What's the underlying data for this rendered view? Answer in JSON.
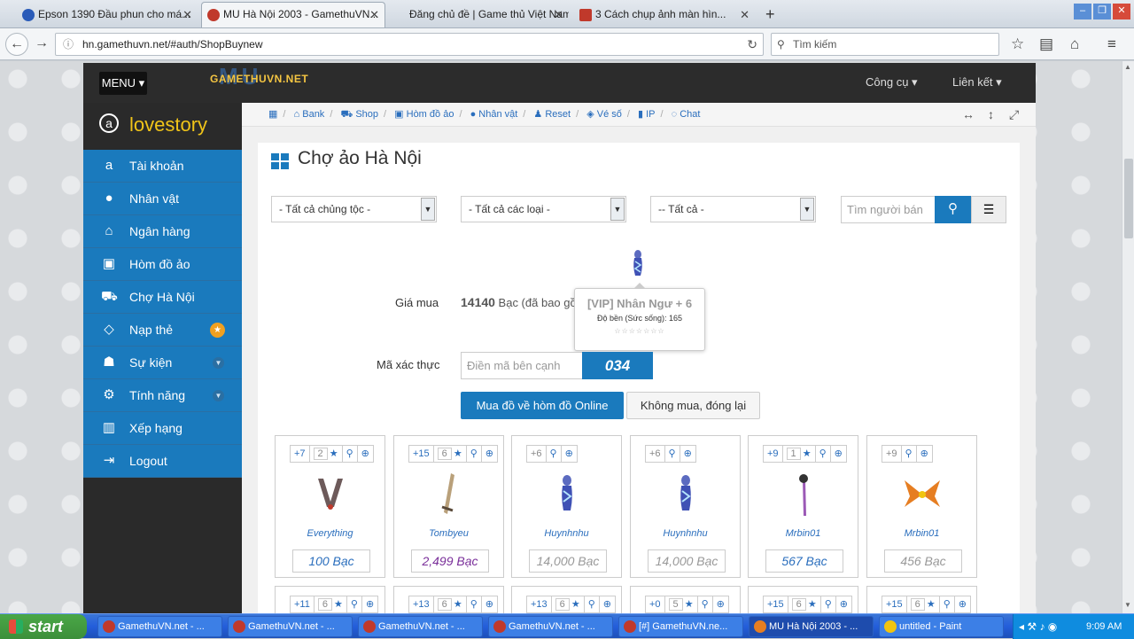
{
  "browser": {
    "tabs": [
      {
        "label": "Epson 1390 Đầu phun cho má...",
        "color": "#2a5bb8"
      },
      {
        "label": "MU Hà Nội 2003 - GamethuVN...",
        "color": "#c0392b"
      },
      {
        "label": "Đăng chủ đề | Game thủ Việt Nam...",
        "color": "#c0392b"
      },
      {
        "label": "3 Cách chụp ảnh màn hìn...",
        "color": "#c0392b"
      }
    ],
    "url": "hn.gamethuvn.net/#auth/ShopBuynew",
    "search_placeholder": "Tìm kiếm"
  },
  "site": {
    "menu_label": "MENU ▾",
    "logo_text": "GAMETHUVN.NET",
    "logo_mu": "MU",
    "nav_tools": "Công cụ ▾",
    "nav_links": "Liên kết ▾"
  },
  "sidebar": {
    "user": "lovestory",
    "items": [
      {
        "label": "Tài khoản"
      },
      {
        "label": "Nhân vật"
      },
      {
        "label": "Ngân hàng"
      },
      {
        "label": "Hòm đồ ảo"
      },
      {
        "label": "Chợ Hà Nội"
      },
      {
        "label": "Nạp thẻ"
      },
      {
        "label": "Sự kiện"
      },
      {
        "label": "Tính năng"
      },
      {
        "label": "Xếp hạng"
      },
      {
        "label": "Logout"
      }
    ]
  },
  "breadcrumbs": [
    "Bank",
    "Shop",
    "Hòm đồ ảo",
    "Nhân vật",
    "Reset",
    "Vé số",
    "IP",
    "Chat"
  ],
  "main": {
    "title": "Chợ ảo Hà Nội",
    "filter_race": "- Tất cả chủng tộc -",
    "filter_type": "- Tất cả các loại -",
    "filter_all": "-- Tất cả -",
    "seller_placeholder": "Tìm người bán",
    "price_label": "Giá mua",
    "price_value": "14140",
    "price_suffix": " Bạc (đã bao gồm",
    "captcha_label": "Mã xác thực",
    "captcha_placeholder": "Điền mã bên cạnh",
    "captcha_text": "034",
    "buy_button": "Mua đồ về hòm đồ Online",
    "cancel_button": "Không mua, đóng lại"
  },
  "tooltip": {
    "title": "[VIP] Nhân Ngư + 6",
    "line": "Độ bền (Sức sống): 165",
    "stars": "☆☆☆☆☆☆☆"
  },
  "items": [
    {
      "level": "+7",
      "stars": "2",
      "seller": "Everything",
      "price": "100 Bạc",
      "active": true,
      "color": "#2a6ebd"
    },
    {
      "level": "+15",
      "stars": "6",
      "seller": "Tombyeu",
      "price": "2,499 Bạc",
      "active": true,
      "color": "#7a2f9a"
    },
    {
      "level": "+6",
      "stars": "",
      "seller": "Huynhnhu",
      "price": "14,000 Bạc",
      "active": false,
      "color": "#999999"
    },
    {
      "level": "+6",
      "stars": "",
      "seller": "Huynhnhu",
      "price": "14,000 Bạc",
      "active": false,
      "color": "#999999"
    },
    {
      "level": "+9",
      "stars": "1",
      "seller": "Mrbin01",
      "price": "567 Bạc",
      "active": true,
      "color": "#2a6ebd"
    },
    {
      "level": "+9",
      "stars": "",
      "seller": "Mrbin01",
      "price": "456 Bạc",
      "active": false,
      "color": "#999999"
    }
  ],
  "items_row2": [
    {
      "level": "+11",
      "stars": "6"
    },
    {
      "level": "+13",
      "stars": "6"
    },
    {
      "level": "+13",
      "stars": "6"
    },
    {
      "level": "+0",
      "stars": "5"
    },
    {
      "level": "+15",
      "stars": "6"
    },
    {
      "level": "+15",
      "stars": "6"
    }
  ],
  "taskbar": {
    "start": "start",
    "items": [
      "GamethuVN.net - ...",
      "GamethuVN.net - ...",
      "GamethuVN.net - ...",
      "GamethuVN.net - ...",
      "[#] GamethuVN.ne...",
      "MU Hà Nội 2003 - ...",
      "untitled - Paint"
    ],
    "clock": "9:09 AM"
  }
}
